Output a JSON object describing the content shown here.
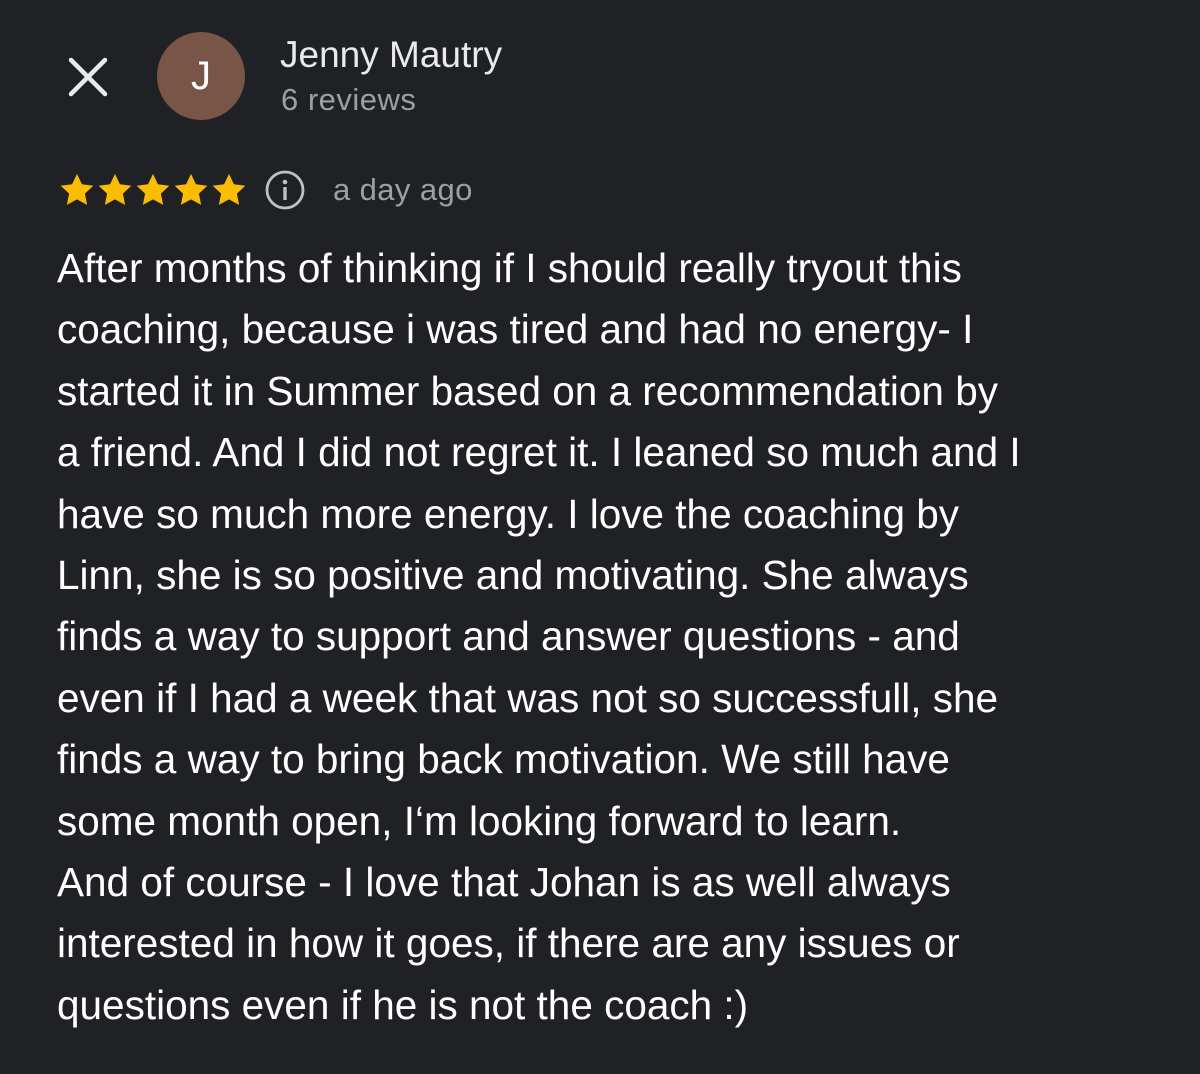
{
  "header": {
    "close_icon": "close-icon",
    "avatar_initial": "J",
    "avatar_color": "#795548",
    "reviewer_name": "Jenny Mautry",
    "review_count": "6 reviews"
  },
  "rating": {
    "stars": 5,
    "max_stars": 5,
    "star_color": "#fbbc04",
    "info_icon": "info-icon",
    "time_ago": "a day ago"
  },
  "review": {
    "lines": [
      "After months of thinking if I should really tryout this",
      "coaching, because i was tired and had no energy- I",
      "started it in Summer based on a recommendation by",
      "a friend. And I did not regret it. I leaned so much and I",
      "have so much more energy. I love the coaching by",
      "Linn, she is so positive and motivating. She always",
      "finds a way to support and answer questions - and",
      "even if I had a week that was not so successfull, she",
      "finds a way to bring back motivation. We still have",
      "some month open, I‘m looking forward to learn.",
      "And of course - I love that Johan is as well always",
      "interested in how it goes, if there are any issues or",
      "questions even if he is not the coach :)"
    ]
  }
}
